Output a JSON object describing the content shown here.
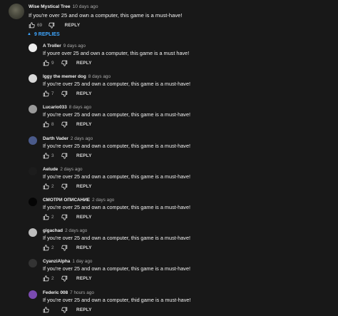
{
  "top_comment": {
    "author": "Wise Mystical Tree",
    "time": "10 days ago",
    "text": "If you're over 25 and own a computer, this game is a must-have!",
    "likes": "69",
    "reply_label": "REPLY"
  },
  "replies_toggle": {
    "label": "9 REPLIES",
    "chevron_icon": "chevron-up-icon",
    "color": "#3ea6ff"
  },
  "replies": [
    {
      "author": "A Troller",
      "time": "9 days ago",
      "text": "If youre over 25 and own a computer, this game is a must have!",
      "likes": "9",
      "reply_label": "REPLY",
      "avatar_color": "#eeeeee"
    },
    {
      "author": "Iggy the memer dog",
      "time": "8 days ago",
      "text": "If you're over 25 and own a computer, this game is a must-have!",
      "likes": "7",
      "reply_label": "REPLY",
      "avatar_color": "#d8d8d8"
    },
    {
      "author": "Lucario033",
      "time": "8 days ago",
      "text": "If you're over 25 and own a computer, this game is a must-have!",
      "likes": "8",
      "reply_label": "REPLY",
      "avatar_color": "#9a9a9a"
    },
    {
      "author": "Darth Vader",
      "time": "2 days ago",
      "text": "If you're over 25 and own a computer, this game is a must-have!",
      "likes": "3",
      "reply_label": "REPLY",
      "avatar_color": "#4a5a8a"
    },
    {
      "author": "Aelude",
      "time": "2 days ago",
      "text": "If you're over 25 and own a computer, this game is a must-have!",
      "likes": "2",
      "reply_label": "REPLY",
      "avatar_color": "#1c1c1c"
    },
    {
      "author": "СМОТРИ ОПИСАНИЕ",
      "time": "2 days ago",
      "text": "If you're over 25 and own a computer, this game is a must-have!",
      "likes": "2",
      "reply_label": "REPLY",
      "avatar_color": "#050505"
    },
    {
      "author": "gigachad",
      "time": "2 days ago",
      "text": "If you're over 25 and own a computer, this game is a must-have!",
      "likes": "2",
      "reply_label": "REPLY",
      "avatar_color": "#bdbdbd"
    },
    {
      "author": "CyanziAlpha",
      "time": "1 day ago",
      "text": "If you're over 25 and own a computer, this game is a must-have!",
      "likes": "2",
      "reply_label": "REPLY",
      "avatar_color": "#333333"
    },
    {
      "author": "Federic 008",
      "time": "7 hours ago",
      "text": "If you're over 25 and own a computer, thid game is a must-have!",
      "likes": "",
      "reply_label": "REPLY",
      "avatar_color": "#7a4ab0"
    }
  ]
}
